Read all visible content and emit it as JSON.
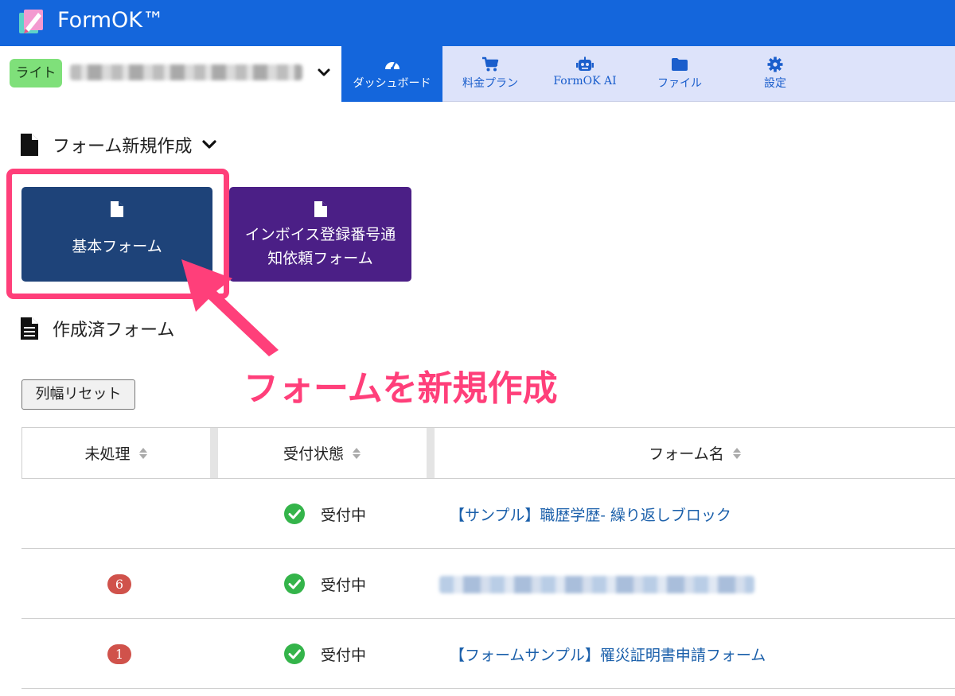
{
  "app": {
    "title": "FormOK™"
  },
  "account": {
    "plan_badge": "ライト"
  },
  "nav": [
    {
      "label": "ダッシュボード",
      "icon": "dashboard-icon",
      "active": true
    },
    {
      "label": "料金プラン",
      "icon": "cart-icon",
      "active": false
    },
    {
      "label": "FormOK AI",
      "icon": "robot-icon",
      "active": false
    },
    {
      "label": "ファイル",
      "icon": "folder-icon",
      "active": false
    },
    {
      "label": "設定",
      "icon": "gear-icon",
      "active": false
    }
  ],
  "new_form": {
    "title": "フォーム新規作成",
    "tiles": [
      {
        "label": "基本フォーム",
        "color": "#1e4379"
      },
      {
        "label_line1": "インボイス登録番号通",
        "label_line2": "知依頼フォーム",
        "color": "#4b1f86"
      }
    ]
  },
  "annotation": {
    "text": "フォームを新規作成",
    "color": "#ff3f7a"
  },
  "created_forms": {
    "title": "作成済フォーム",
    "reset_button": "列幅リセット",
    "columns": [
      "未処理",
      "受付状態",
      "フォーム名"
    ],
    "rows": [
      {
        "pending": "",
        "status": "受付中",
        "name": "【サンプル】職歴学歴- 繰り返しブロック"
      },
      {
        "pending": "6",
        "status": "受付中",
        "name": ""
      },
      {
        "pending": "1",
        "status": "受付中",
        "name": "【フォームサンプル】罹災証明書申請フォーム"
      }
    ]
  },
  "colors": {
    "brand": "#1466dc",
    "nav_bg": "#dde3fa",
    "link": "#1a5faa",
    "badge": "#d0524b",
    "ok": "#34b44a"
  }
}
